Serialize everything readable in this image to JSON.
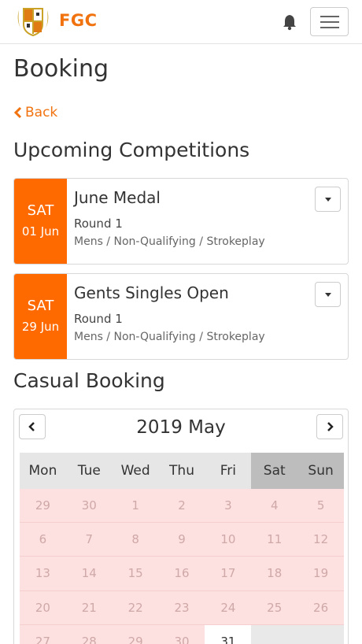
{
  "header": {
    "brand": "FGC",
    "logo": "club-crest-icon",
    "bell": "bell-icon",
    "menu": "hamburger-icon"
  },
  "page": {
    "title": "Booking",
    "back_label": "Back"
  },
  "competitions": {
    "heading": "Upcoming Competitions",
    "items": [
      {
        "day": "SAT",
        "date": "01 Jun",
        "name": "June Medal",
        "round": "Round 1",
        "category": "Mens / Non-Qualifying / Strokeplay"
      },
      {
        "day": "SAT",
        "date": "29 Jun",
        "name": "Gents Singles Open",
        "round": "Round 1",
        "category": "Mens / Non-Qualifying / Strokeplay"
      }
    ]
  },
  "casual": {
    "heading": "Casual Booking",
    "calendar": {
      "title": "2019 May",
      "weekdays": [
        "Mon",
        "Tue",
        "Wed",
        "Thu",
        "Fri",
        "Sat",
        "Sun"
      ],
      "weeks": [
        [
          "29",
          "30",
          "1",
          "2",
          "3",
          "4",
          "5"
        ],
        [
          "6",
          "7",
          "8",
          "9",
          "10",
          "11",
          "12"
        ],
        [
          "13",
          "14",
          "15",
          "16",
          "17",
          "18",
          "19"
        ],
        [
          "20",
          "21",
          "22",
          "23",
          "24",
          "25",
          "26"
        ],
        [
          "27",
          "28",
          "29",
          "30",
          "31",
          "",
          ""
        ]
      ]
    }
  },
  "colors": {
    "accent": "#f0730f",
    "date_badge": "#ff6a00",
    "unavailable": "#fde0e0",
    "weekend_header": "#bdbdbd"
  }
}
